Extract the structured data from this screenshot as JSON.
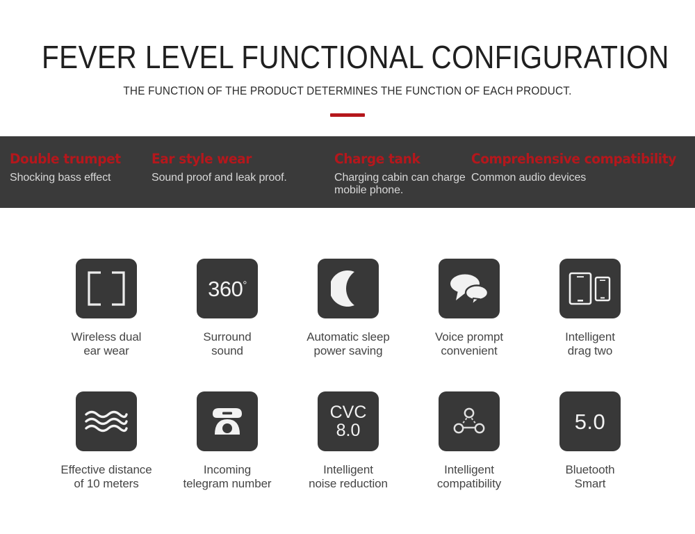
{
  "header": {
    "title": "FEVER LEVEL FUNCTIONAL CONFIGURATION",
    "subtitle": "THE FUNCTION OF THE PRODUCT DETERMINES THE FUNCTION OF EACH PRODUCT.",
    "accent_color": "#b5171c"
  },
  "banner": {
    "background_color": "#3a3a3a",
    "heading_color": "#b5171c",
    "description_color": "#d8d8d8",
    "items": [
      {
        "heading": "Double trumpet",
        "description": "Shocking bass effect"
      },
      {
        "heading": "Ear style wear",
        "description": "Sound proof and leak proof."
      },
      {
        "heading": "Charge tank",
        "description": "Charging cabin can charge mobile phone."
      },
      {
        "heading": "Comprehensive compatibility",
        "description": "Common audio devices"
      }
    ]
  },
  "features": {
    "tile_color": "#383838",
    "label_color": "#454545",
    "row1": [
      {
        "icon": "earbuds-brackets-icon",
        "label": "Wireless dual\near wear"
      },
      {
        "icon": "360-degree-surround-icon",
        "text": "360",
        "superscript": "°",
        "label": "Surround\nsound"
      },
      {
        "icon": "crescent-moon-icon",
        "label": "Automatic sleep\npower saving"
      },
      {
        "icon": "speech-bubbles-icon",
        "label": "Voice prompt\nconvenient"
      },
      {
        "icon": "two-devices-icon",
        "label": "Intelligent\ndrag two"
      }
    ],
    "row2": [
      {
        "icon": "signal-waves-icon",
        "label": "Effective distance\nof 10 meters"
      },
      {
        "icon": "rotary-telephone-icon",
        "label": "Incoming\ntelegram number"
      },
      {
        "icon": "cvc-text-icon",
        "text_line1": "CVC",
        "text_line2": "8.0",
        "label": "Intelligent\nnoise reduction"
      },
      {
        "icon": "network-nodes-icon",
        "label": "Intelligent\ncompatibility"
      },
      {
        "icon": "bluetooth-version-icon",
        "text": "5.0",
        "label": "Bluetooth\nSmart"
      }
    ]
  }
}
